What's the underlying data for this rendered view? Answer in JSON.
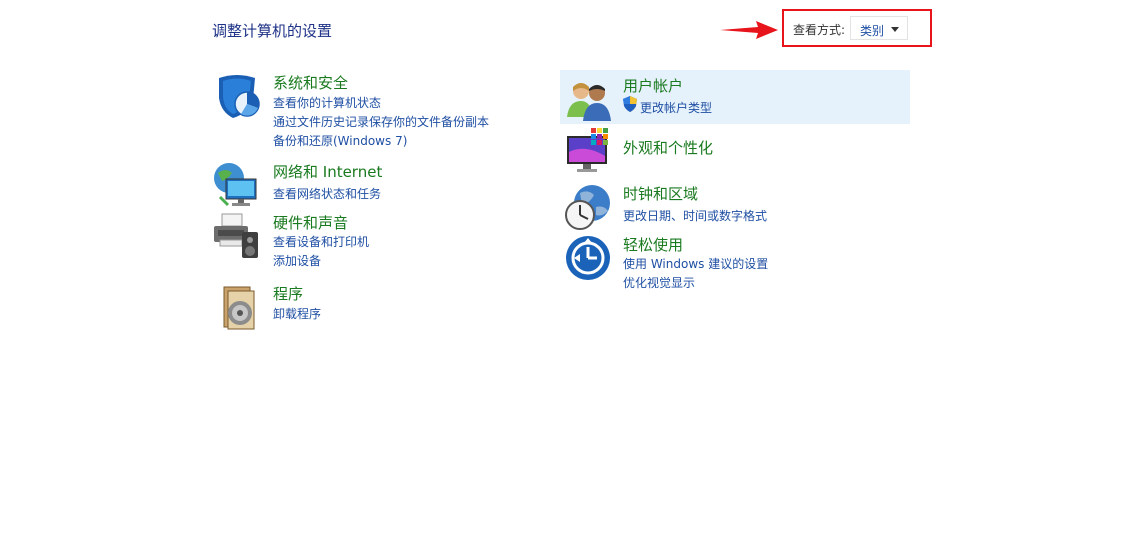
{
  "header": {
    "title": "调整计算机的设置",
    "view_by_label": "查看方式:",
    "view_by_value": "类别"
  },
  "left_categories": [
    {
      "title": "系统和安全",
      "icon": "shield-icon",
      "links": [
        "查看你的计算机状态",
        "通过文件历史记录保存你的文件备份副本",
        "备份和还原(Windows 7)"
      ]
    },
    {
      "title": "网络和 Internet",
      "icon": "network-globe-icon",
      "links": [
        "查看网络状态和任务"
      ]
    },
    {
      "title": "硬件和声音",
      "icon": "printer-speaker-icon",
      "links": [
        "查看设备和打印机",
        "添加设备"
      ]
    },
    {
      "title": "程序",
      "icon": "programs-disc-icon",
      "links": [
        "卸载程序"
      ]
    }
  ],
  "right_categories": [
    {
      "title": "用户帐户",
      "icon": "users-icon",
      "links": [
        "更改帐户类型"
      ]
    },
    {
      "title": "外观和个性化",
      "icon": "monitor-palette-icon",
      "links": []
    },
    {
      "title": "时钟和区域",
      "icon": "clock-globe-icon",
      "links": [
        "更改日期、时间或数字格式"
      ]
    },
    {
      "title": "轻松使用",
      "icon": "ease-of-access-icon",
      "links": [
        "使用 Windows 建议的设置",
        "优化视觉显示"
      ]
    }
  ],
  "colors": {
    "title_blue": "#1e3287",
    "category_green": "#1a7a1f",
    "link_blue": "#1f4fa3",
    "annotation_red": "#e8141c",
    "hover_bg": "#e6f2fb"
  }
}
